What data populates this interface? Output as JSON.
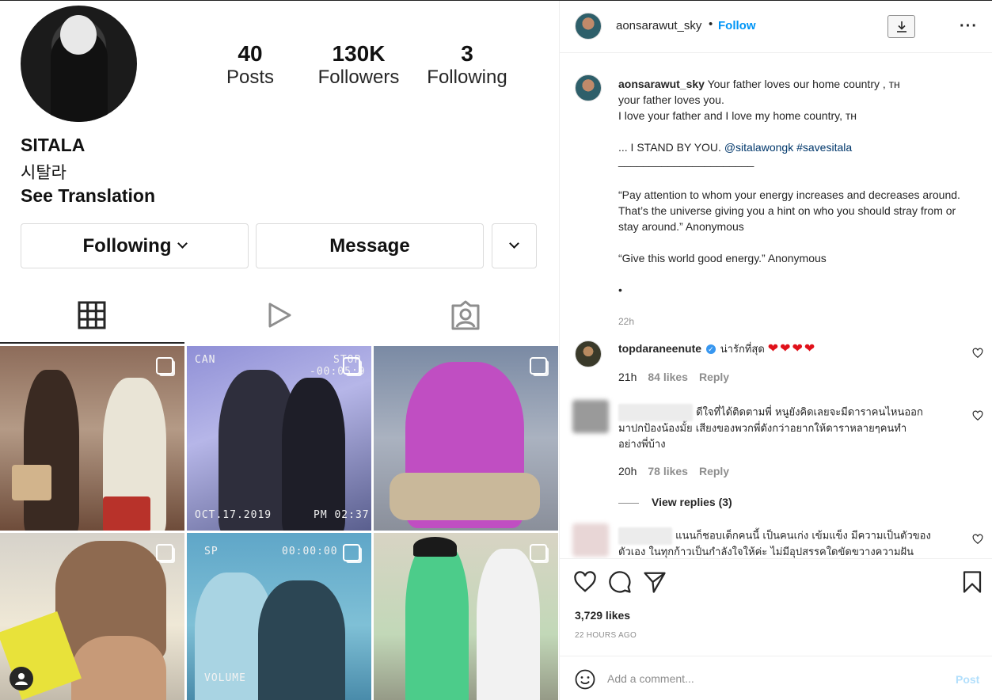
{
  "profile": {
    "stats": [
      {
        "num": "40",
        "label": "Posts"
      },
      {
        "num": "130K",
        "label": "Followers"
      },
      {
        "num": "3",
        "label": "Following"
      }
    ],
    "name": "SITALA",
    "name_alt": "시탈라",
    "see_translation": "See Translation",
    "following_button": "Following",
    "message_button": "Message"
  },
  "grid_captions": {
    "c2_top_left": "CAN",
    "c2_top_right": "STOP",
    "c2_timer": "-00:05:9",
    "c2_date": "OCT.17.2019",
    "c2_time": "PM 02:37",
    "c5_top_left": "SP",
    "c5_timer": "00:00:00",
    "c5_bottom": "VOLUME"
  },
  "post": {
    "username": "aonsarawut_sky",
    "follow": "Follow",
    "caption": {
      "username": "aonsarawut_sky",
      "line1": "Your father loves our home country , ᴛʜ",
      "line2": "your father loves you.",
      "line3": "I love your father and I love my home country, ᴛʜ",
      "line4_prefix": "... I STAND BY YOU. ",
      "mention": "@sitalawongk",
      "hashtag": "#savesitala",
      "divider": "______________________",
      "quote1": "“Pay attention to whom your energy increases and decreases around. That’s the universe giving you a hint on who you should stray from or stay around.” Anonymous",
      "quote2": "“Give this world good energy.” Anonymous",
      "bullet": "•",
      "age": "22h"
    },
    "comments": [
      {
        "username": "topdaraneenute",
        "text": "น่ารักที่สุด",
        "hearts": "❤❤❤❤",
        "age": "21h",
        "likes": "84 likes",
        "reply": "Reply"
      },
      {
        "text_line1": "ดีใจที่ได้ติดตามพี่ หนูยังคิดเลยจะมีดาราคนไหนออก",
        "text_line2": "มาปกป้องน้องมั้ย เสียงของพวกพี่ดังกว่าอยากให้ดาราหลายๆคนทำ",
        "text_line3": "อย่างพี่บ้าง",
        "age": "20h",
        "likes": "78 likes",
        "reply": "Reply",
        "view_replies": "View replies (3)"
      },
      {
        "text_line1": "แนนก็ชอบเด็กคนนี้ เป็นคนเก่ง เข้มแข็ง มีความเป็นตัวของ",
        "text_line2": "ตัวเอง ในทุกก้าวเป็นกำลังใจให้ค่ะ ไม่มีอุปสรรคใดขัดขวางความฝัน"
      }
    ],
    "likes": "3,729 likes",
    "timestamp": "22 HOURS AGO",
    "add_comment_placeholder": "Add a comment...",
    "post_button": "Post"
  },
  "colors": {
    "accent": "#0095f6",
    "link": "#00376b",
    "heart_red": "#e0111a",
    "post_disabled": "#b2dffc"
  }
}
